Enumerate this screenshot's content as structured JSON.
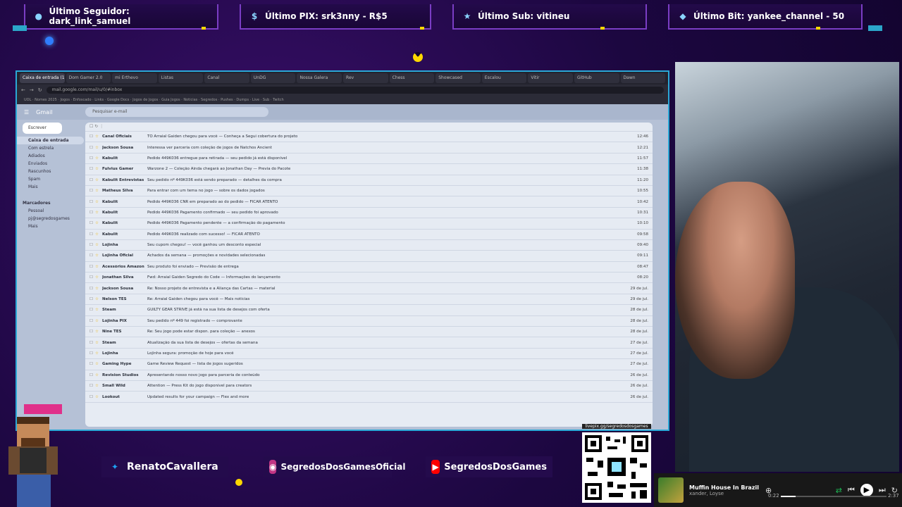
{
  "alerts": [
    {
      "label": "Último Seguidor: dark_link_samuel",
      "icon": "user-icon"
    },
    {
      "label": "Último PIX: srk3nny - R$5",
      "icon": "dollar-icon"
    },
    {
      "label": "Último Sub: vitineu",
      "icon": "star-icon"
    },
    {
      "label": "Último Bit: yankee_channel - 50",
      "icon": "diamond-icon"
    }
  ],
  "browser": {
    "tabs": [
      "Caixa de entrada (1)",
      "Dom Gamer 2.0",
      "mi Erthevo",
      "Listas",
      "Canal",
      "UnDG",
      "Nossa Galera",
      "Rev",
      "Chess",
      "Showcased",
      "Escalou",
      "Vitir",
      "GitHub",
      "Dawn"
    ],
    "url": "mail.google.com/mail/u/0/#inbox",
    "bookmarks": "UOL · Nomes 2025 · Jogos · Enfoscado · Links · Google Docs · Jogos de Jogos · Guia Jogos · Noticias · Segredos · Pushes · Dumps · Live · Sub · Twitch"
  },
  "gmail": {
    "logo": "Gmail",
    "search_placeholder": "Pesquisar e-mail",
    "compose": "Escrever",
    "folders": [
      "Caixa de entrada",
      "Com estrela",
      "Adiados",
      "Enviados",
      "Rascunhos",
      "Spam",
      "Mais"
    ],
    "labels_title": "Marcadores",
    "labels": [
      "Pessoal",
      "pj@segredosgames",
      "Mais"
    ],
    "rows": [
      {
        "sender": "Canal Oficiais",
        "subject": "TO Arraial Gaiden chegou para você — Conheça a Segui cobertura do projeto",
        "date": "12:46"
      },
      {
        "sender": "Jackson Sousa",
        "subject": "Interessa ver parceria com coleção de jogos de Natchos Ancient",
        "date": "12:21"
      },
      {
        "sender": "Kabulit",
        "subject": "Pedido 449K036 entregue para retirada — seu pedido já está disponível",
        "date": "11:57"
      },
      {
        "sender": "Fulvius Gamer",
        "subject": "Warzone 2 — Coleção Ainda chegará ao Jonathan Day — Previa do Pacote",
        "date": "11:38"
      },
      {
        "sender": "Kabulit Entrevistas",
        "subject": "Seu pedido nº 449K036 está sendo preparado — detalhes da compra",
        "date": "11:20"
      },
      {
        "sender": "Matheus Silva",
        "subject": "Para entrar com um tema no jogo — sobre os dados jogados",
        "date": "10:55"
      },
      {
        "sender": "Kabulit",
        "subject": "Pedido 449K036 CNR em preparado ao do pedido — FICAR ATENTO",
        "date": "10:42"
      },
      {
        "sender": "Kabulit",
        "subject": "Pedido 449K036 Pagamento confirmado — seu pedido foi aprovado",
        "date": "10:31"
      },
      {
        "sender": "Kabulit",
        "subject": "Pedido 449K036 Pagamento pendente — a confirmação do pagamento",
        "date": "10:10"
      },
      {
        "sender": "Kabulit",
        "subject": "Pedido 449K036 realizado com sucesso! — FICAR ATENTO",
        "date": "09:58"
      },
      {
        "sender": "Lojinha",
        "subject": "Seu cupom chegou! — você ganhou um desconto especial",
        "date": "09:40"
      },
      {
        "sender": "Lojinha Oficial",
        "subject": "Achados da semana — promoções e novidades selecionadas",
        "date": "09:11"
      },
      {
        "sender": "Acessórios Amazon",
        "subject": "Seu produto foi enviado — Previsão de entrega",
        "date": "08:47"
      },
      {
        "sender": "Jonathan Silva",
        "subject": "Fwd: Arraial Gaiden Segredo do Code — Informações do lançamento",
        "date": "08:20"
      },
      {
        "sender": "Jackson Sousa",
        "subject": "Re: Nosso projeto de entrevista e a Aliança das Cartas — material",
        "date": "29 de jul."
      },
      {
        "sender": "Nelson TES",
        "subject": "Re: Arraial Gaiden chegou para você — Mais notícias",
        "date": "29 de jul."
      },
      {
        "sender": "Steam",
        "subject": "GUILTY GEAR STRIVE já está na sua lista de desejos com oferta",
        "date": "28 de jul."
      },
      {
        "sender": "Lojinha PIX",
        "subject": "Seu pedido nº 449 foi registrado — comprovante",
        "date": "28 de jul."
      },
      {
        "sender": "Nine TES",
        "subject": "Re: Seu jogo pode estar dispon. para coleção — anexos",
        "date": "28 de jul."
      },
      {
        "sender": "Steam",
        "subject": "Atualização da sua lista de desejos — ofertas da semana",
        "date": "27 de jul."
      },
      {
        "sender": "Lojinha",
        "subject": "Lojinha segura: promoção de hoje para você",
        "date": "27 de jul."
      },
      {
        "sender": "Gaming Hype",
        "subject": "Game Review Request — lista de jogos sugeridos",
        "date": "27 de jul."
      },
      {
        "sender": "Revision Studios",
        "subject": "Apresentando nosso novo jogo para parceria de conteúdo",
        "date": "26 de jul."
      },
      {
        "sender": "Small Wild",
        "subject": "Attention — Press Kit do jogo disponível para creators",
        "date": "26 de jul."
      },
      {
        "sender": "Lookout",
        "subject": "Updated results for your campaign — Flex and more",
        "date": "26 de jul."
      }
    ]
  },
  "social": [
    {
      "label": "RenatoCavallera",
      "icon": "twitter-icon",
      "color": "#1da1f2"
    },
    {
      "label": "SegredosDosGamesOficial",
      "icon": "instagram-icon",
      "color": "#c13584"
    },
    {
      "label": "SegredosDosGames",
      "icon": "youtube-icon",
      "color": "#ff0000"
    }
  ],
  "qr_label": "livepix.gg/segredosdosgames",
  "player": {
    "song": "Muffin House In Brazil",
    "artist": "xander, Loyse",
    "elapsed": "0:22",
    "total": "2:37",
    "progress": 0.14
  }
}
